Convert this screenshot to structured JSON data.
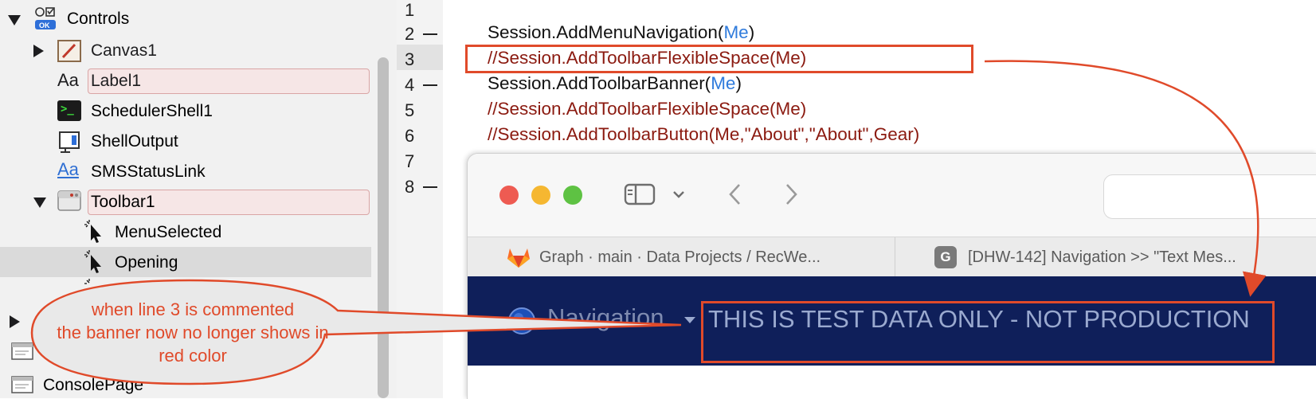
{
  "navigator": {
    "controls": {
      "label": "Controls",
      "badge": "OK"
    },
    "items": [
      {
        "label": "Canvas1"
      },
      {
        "label": "Label1",
        "icon": "Aa"
      },
      {
        "label": "SchedulerShell1",
        "icon": ">_"
      },
      {
        "label": "ShellOutput"
      },
      {
        "label": "SMSStatusLink",
        "icon": "Aa"
      },
      {
        "label": "Toolbar1"
      },
      {
        "label": "MenuSelected"
      },
      {
        "label": "Opening"
      },
      {
        "label": "ConsolePage"
      }
    ]
  },
  "editor": {
    "line_numbers": [
      "1",
      "2",
      "3",
      "4",
      "5",
      "6",
      "7",
      "8"
    ],
    "lines": [
      {
        "pre": "Session.AddMenuNavigation(",
        "kw": "Me",
        "post": ")"
      },
      {
        "text": "//Session.AddToolbarFlexibleSpace(Me)"
      },
      {
        "pre": "Session.AddToolbarBanner(",
        "kw": "Me",
        "post": ")"
      },
      {
        "text": "//Session.AddToolbarFlexibleSpace(Me)"
      },
      {
        "text": "//Session.AddToolbarButton(Me,\"About\",\"About\",Gear)"
      }
    ]
  },
  "browser": {
    "tabs": [
      {
        "label": "Graph · main · Data Projects / RecWe...",
        "icon": "gitlab-icon"
      },
      {
        "label": "[DHW-142] Navigation >> \"Text Mes...",
        "icon": "G"
      }
    ],
    "navbar": {
      "nav_label": "Navigation",
      "banner": "THIS IS TEST DATA ONLY - NOT PRODUCTION"
    }
  },
  "annotation": {
    "lines": [
      "when line 3 is commented",
      "the banner now no longer shows in",
      "red color"
    ]
  },
  "colors": {
    "annotation": "#e04a2a",
    "comment": "#8b1a10",
    "keyword": "#2f7bdc",
    "navbar": "#0f1f5a"
  }
}
